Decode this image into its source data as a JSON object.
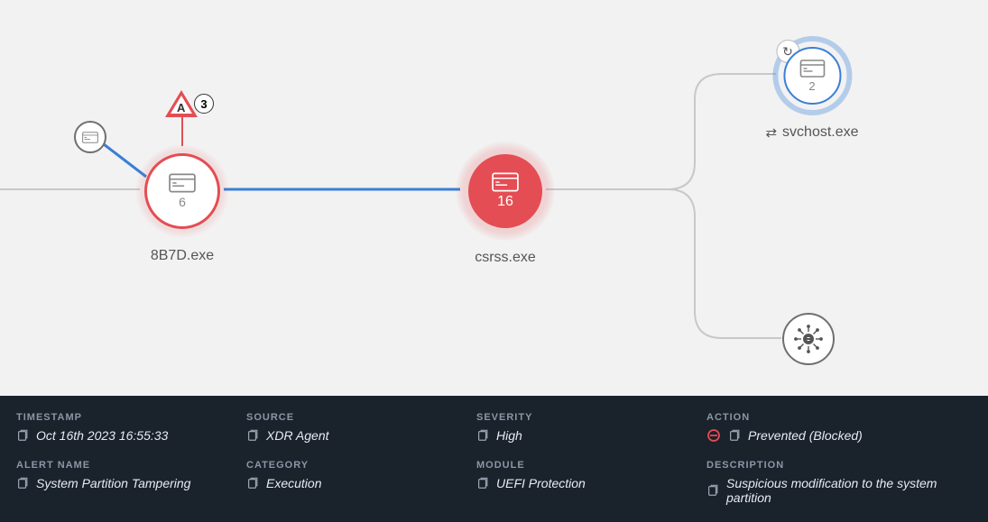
{
  "graph": {
    "parent": {
      "label": ""
    },
    "alert_marker": {
      "letter": "A",
      "count": "3"
    },
    "node_main": {
      "label": "8B7D.exe",
      "count": "6"
    },
    "node_filled": {
      "label": "csrss.exe",
      "count": "16"
    },
    "node_blue": {
      "label": "svchost.exe",
      "count": "2"
    },
    "node_network": {
      "label": ""
    }
  },
  "details": {
    "timestamp": {
      "label": "TIMESTAMP",
      "value": "Oct 16th 2023 16:55:33"
    },
    "source": {
      "label": "SOURCE",
      "value": "XDR Agent"
    },
    "severity": {
      "label": "SEVERITY",
      "value": "High"
    },
    "action": {
      "label": "ACTION",
      "value": "Prevented (Blocked)"
    },
    "alert_name": {
      "label": "ALERT NAME",
      "value": "System Partition Tampering"
    },
    "category": {
      "label": "CATEGORY",
      "value": "Execution"
    },
    "module": {
      "label": "MODULE",
      "value": "UEFI Protection"
    },
    "description": {
      "label": "DESCRIPTION",
      "value": "Suspicious modification to the system partition"
    }
  }
}
